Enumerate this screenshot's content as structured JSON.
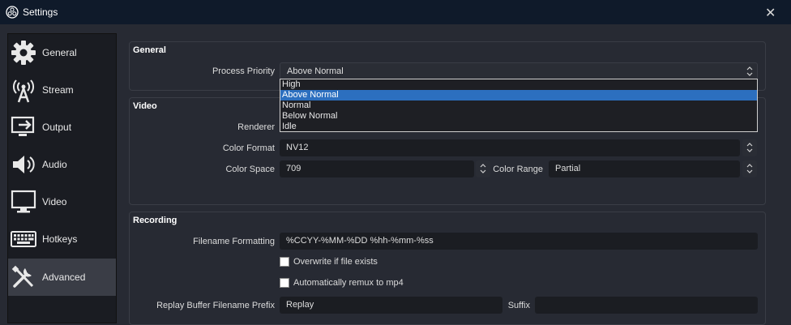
{
  "window": {
    "title": "Settings",
    "close_glyph": "✕"
  },
  "sidebar": {
    "items": [
      {
        "label": "General",
        "icon": "gear-icon"
      },
      {
        "label": "Stream",
        "icon": "broadcast-tower-icon"
      },
      {
        "label": "Output",
        "icon": "output-monitor-icon"
      },
      {
        "label": "Audio",
        "icon": "speaker-icon"
      },
      {
        "label": "Video",
        "icon": "monitor-icon"
      },
      {
        "label": "Hotkeys",
        "icon": "keyboard-icon"
      },
      {
        "label": "Advanced",
        "icon": "tools-icon",
        "active": true
      }
    ]
  },
  "general": {
    "title": "General",
    "process_priority_label": "Process Priority",
    "process_priority_value": "Above Normal",
    "process_priority_options": [
      "High",
      "Above Normal",
      "Normal",
      "Below Normal",
      "Idle"
    ],
    "selected_index": 1
  },
  "video": {
    "title": "Video",
    "renderer_label": "Renderer",
    "color_format_label": "Color Format",
    "color_format_value": "NV12",
    "color_space_label": "Color Space",
    "color_space_value": "709",
    "color_range_label": "Color Range",
    "color_range_value": "Partial"
  },
  "recording": {
    "title": "Recording",
    "filename_formatting_label": "Filename Formatting",
    "filename_formatting_value": "%CCYY-%MM-%DD %hh-%mm-%ss",
    "overwrite_label": "Overwrite if file exists",
    "overwrite_checked": false,
    "remux_label": "Automatically remux to mp4",
    "remux_checked": false,
    "replay_prefix_label": "Replay Buffer Filename Prefix",
    "replay_prefix_value": "Replay",
    "suffix_label": "Suffix",
    "suffix_value": ""
  },
  "colors": {
    "background": "#272a33",
    "sidebar": "#1a1c22",
    "titlebar": "#0f1a2a",
    "selection": "#2c6fbf"
  }
}
